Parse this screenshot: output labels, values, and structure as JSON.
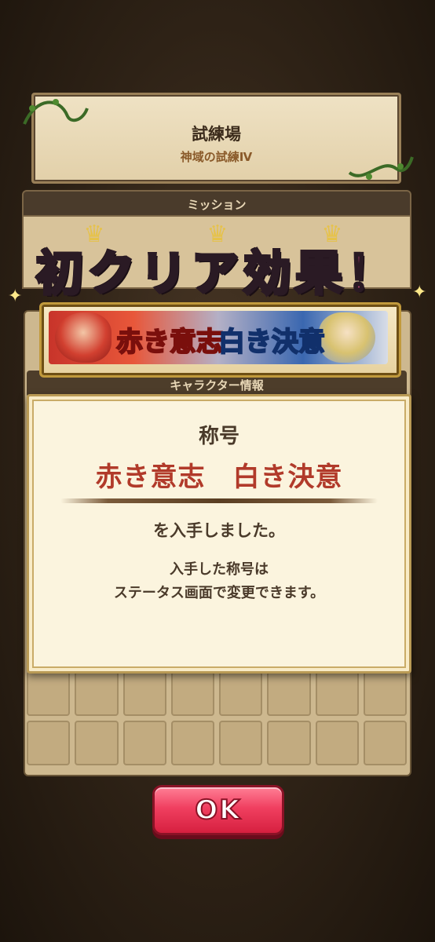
{
  "header": {
    "title": "試練場",
    "subtitle": "神域の試練Ⅳ"
  },
  "mission": {
    "label": "ミッション"
  },
  "banner": {
    "text": "初クリア効果！"
  },
  "title_ribbon": {
    "red_text": "赤き意志",
    "blue_text": "白き決意"
  },
  "character_panel": {
    "header": "キャラクター情報"
  },
  "dialog": {
    "label": "称号",
    "title": "赤き意志　白き決意",
    "obtained": "を入手しました。",
    "note_line1": "入手した称号は",
    "note_line2": "ステータス画面で変更できます。"
  },
  "ok_button": {
    "label": "OK"
  },
  "colors": {
    "accent_red": "#b13a2a",
    "button_pink": "#f03f60",
    "banner_pink": "#d24a84"
  }
}
